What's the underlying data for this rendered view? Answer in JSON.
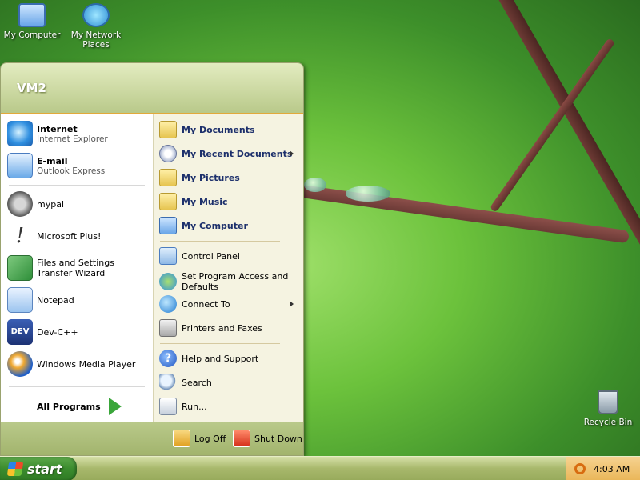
{
  "desktop": {
    "icons": [
      {
        "label": "My Computer",
        "icon": "computer-icon"
      },
      {
        "label": "My Network Places",
        "icon": "network-icon"
      },
      {
        "label": "Recycle Bin",
        "icon": "recycle-bin-icon"
      }
    ]
  },
  "start_menu": {
    "user": "VM2",
    "pinned": [
      {
        "title": "Internet",
        "subtitle": "Internet Explorer",
        "icon": "internet-explorer-icon"
      },
      {
        "title": "E-mail",
        "subtitle": "Outlook Express",
        "icon": "outlook-express-icon"
      }
    ],
    "recent": [
      {
        "label": "mypal",
        "icon": "mypal-raccoon-icon"
      },
      {
        "label": "Microsoft Plus!",
        "icon": "microsoft-plus-icon"
      },
      {
        "label": "Files and Settings Transfer Wizard",
        "icon": "transfer-wizard-icon"
      },
      {
        "label": "Notepad",
        "icon": "notepad-icon"
      },
      {
        "label": "Dev-C++",
        "icon": "dev-cpp-icon"
      },
      {
        "label": "Windows Media Player",
        "icon": "media-player-icon"
      }
    ],
    "dev_icon_text": "DEV",
    "all_programs": "All Programs",
    "right": [
      {
        "label": "My Documents",
        "icon": "my-documents-icon"
      },
      {
        "label": "My Recent Documents",
        "icon": "recent-documents-icon"
      },
      {
        "label": "My Pictures",
        "icon": "my-pictures-icon"
      },
      {
        "label": "My Music",
        "icon": "my-music-icon"
      },
      {
        "label": "My Computer",
        "icon": "my-computer-icon"
      },
      {
        "label": "Control Panel",
        "icon": "control-panel-icon"
      },
      {
        "label": "Set Program Access and Defaults",
        "icon": "program-access-icon"
      },
      {
        "label": "Connect To",
        "icon": "connect-to-icon"
      },
      {
        "label": "Printers and Faxes",
        "icon": "printer-icon"
      },
      {
        "label": "Help and Support",
        "icon": "help-icon"
      },
      {
        "label": "Search",
        "icon": "search-icon"
      },
      {
        "label": "Run...",
        "icon": "run-icon"
      }
    ],
    "help_glyph": "?",
    "log_off": "Log Off",
    "shut_down": "Shut Down"
  },
  "taskbar": {
    "start_label": "start",
    "clock": "4:03 AM"
  }
}
